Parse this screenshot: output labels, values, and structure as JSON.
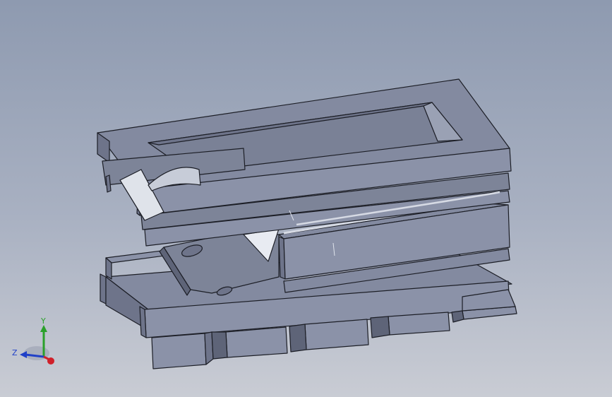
{
  "colors": {
    "background_top": "#8e9ab0",
    "background_bottom": "#c9ccd4",
    "top_face": "#838aa0",
    "front_face": "#8b92a8",
    "side_face": "#6e748a",
    "dark_face": "#5e6478",
    "edge": "#1c1e26",
    "highlight": "#d6dae4",
    "axis_x": "#d0202a",
    "axis_y": "#2aa02a",
    "axis_z": "#2040c8"
  },
  "triad": {
    "x_label": "",
    "y_label": "Y",
    "z_label": "Z",
    "icon": "coordinate-triad-icon"
  }
}
